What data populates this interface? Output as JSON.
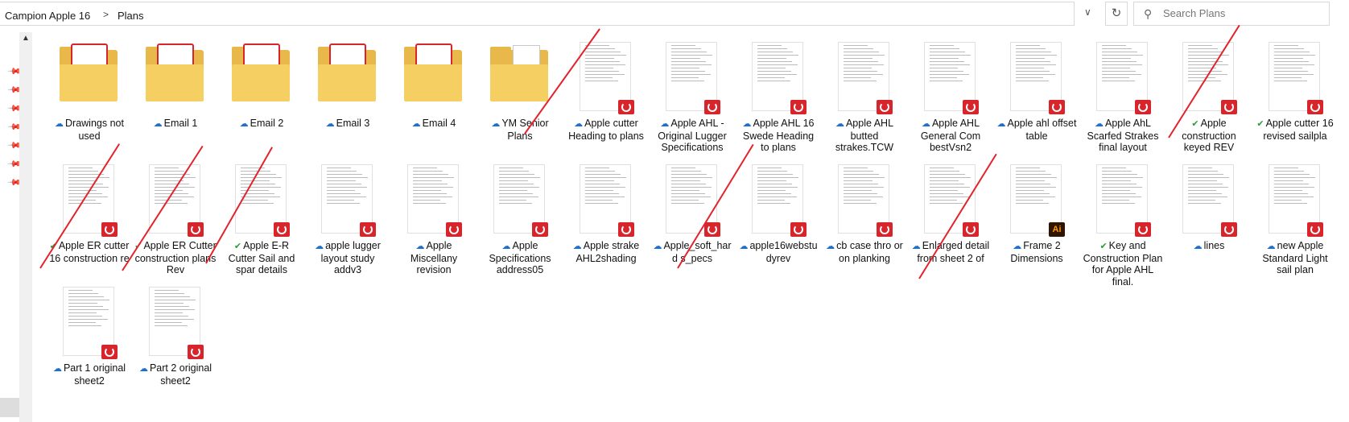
{
  "address": {
    "crumbs": [
      "Campion Apple 16",
      "Plans"
    ],
    "separator": ">"
  },
  "search": {
    "placeholder": "Search Plans"
  },
  "items": [
    {
      "name": "Drawings not used",
      "kind": "folder-pdf",
      "status": "cloud"
    },
    {
      "name": "Email 1",
      "kind": "folder-pdf",
      "status": "cloud"
    },
    {
      "name": "Email 2",
      "kind": "folder-pdf",
      "status": "cloud"
    },
    {
      "name": "Email 3",
      "kind": "folder-pdf",
      "status": "cloud"
    },
    {
      "name": "Email 4",
      "kind": "folder-pdf",
      "status": "cloud"
    },
    {
      "name": "YM Senior Plans",
      "kind": "folder-doc",
      "status": "cloud"
    },
    {
      "name": "Apple  cutter Heading to plans",
      "kind": "pdf",
      "status": "cloud"
    },
    {
      "name": "Apple AHL - Original Lugger Specifications",
      "kind": "pdf",
      "status": "cloud"
    },
    {
      "name": "Apple AHL 16 Swede Heading to plans",
      "kind": "pdf",
      "status": "cloud"
    },
    {
      "name": "Apple AHL butted strakes.TCW",
      "kind": "pdf",
      "status": "cloud"
    },
    {
      "name": "Apple AHL General Com bestVsn2",
      "kind": "pdf",
      "status": "cloud"
    },
    {
      "name": "Apple ahl offset  table",
      "kind": "pdf",
      "status": "cloud"
    },
    {
      "name": "Apple AhL Scarfed Strakes final layout",
      "kind": "pdf",
      "status": "cloud"
    },
    {
      "name": "Apple construction keyed REV",
      "kind": "pdf",
      "status": "check"
    },
    {
      "name": "Apple cutter 16 revised sailpla",
      "kind": "pdf",
      "status": "check"
    },
    {
      "name": "Apple ER cutter 16 construction re",
      "kind": "pdf",
      "status": "check"
    },
    {
      "name": "Apple ER Cutter construction plans Rev",
      "kind": "pdf",
      "status": "check"
    },
    {
      "name": "Apple E-R Cutter Sail and spar details",
      "kind": "pdf",
      "status": "check"
    },
    {
      "name": "apple lugger layout study addv3",
      "kind": "pdf",
      "status": "cloud"
    },
    {
      "name": "Apple Miscellany revision",
      "kind": "pdf",
      "status": "cloud"
    },
    {
      "name": "Apple Specifications address05",
      "kind": "pdf",
      "status": "cloud"
    },
    {
      "name": "Apple strake AHL2shading",
      "kind": "pdf",
      "status": "cloud"
    },
    {
      "name": "Apple_soft_har d s_pecs",
      "kind": "pdf",
      "status": "cloud"
    },
    {
      "name": "apple16webstu dyrev",
      "kind": "pdf",
      "status": "cloud"
    },
    {
      "name": "cb case thro or on planking",
      "kind": "pdf",
      "status": "cloud"
    },
    {
      "name": "Enlarged detail from sheet 2 of",
      "kind": "pdf",
      "status": "cloud"
    },
    {
      "name": "Frame 2 Dimensions",
      "kind": "ai",
      "status": "cloud"
    },
    {
      "name": "Key and Construction Plan for Apple AHL final.",
      "kind": "pdf",
      "status": "check"
    },
    {
      "name": "lines",
      "kind": "pdf",
      "status": "cloud"
    },
    {
      "name": "new Apple Standard Light sail plan",
      "kind": "pdf",
      "status": "cloud"
    },
    {
      "name": "Part 1 original sheet2",
      "kind": "pdf",
      "status": "cloud"
    },
    {
      "name": "Part 2 original sheet2",
      "kind": "pdf",
      "status": "cloud"
    }
  ],
  "icons": {
    "cloud": "cloud-icon",
    "check": "synced-check-icon",
    "pdf": "pdf-badge-icon",
    "ai": "illustrator-badge-icon"
  },
  "colors": {
    "strike": "#e3232c",
    "pdf_red": "#d8242b",
    "folder": "#f6cf62"
  }
}
